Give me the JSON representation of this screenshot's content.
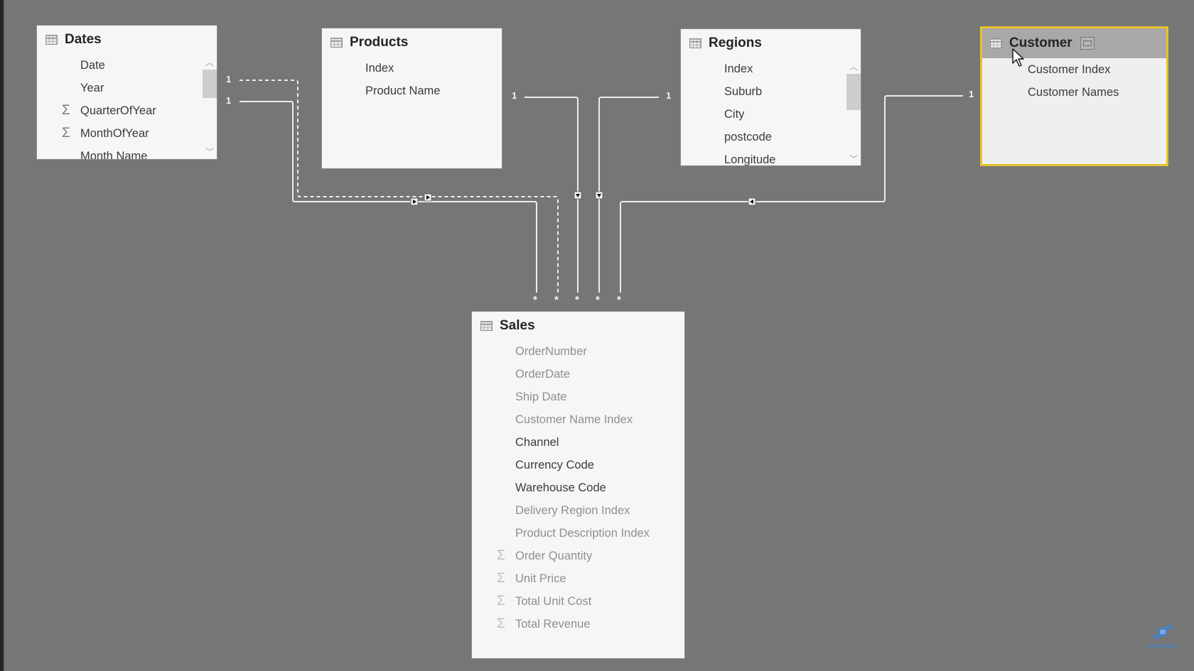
{
  "canvas": {
    "background": "#767676",
    "view": "Model relationships"
  },
  "tables": {
    "dates": {
      "title": "Dates",
      "fields": [
        {
          "name": "Date",
          "sigma": false
        },
        {
          "name": "Year",
          "sigma": false
        },
        {
          "name": "QuarterOfYear",
          "sigma": true
        },
        {
          "name": "MonthOfYear",
          "sigma": true
        },
        {
          "name": "Month Name",
          "sigma": false
        }
      ],
      "scrollable": true
    },
    "products": {
      "title": "Products",
      "fields": [
        {
          "name": "Index",
          "sigma": false
        },
        {
          "name": "Product Name",
          "sigma": false
        }
      ]
    },
    "regions": {
      "title": "Regions",
      "fields": [
        {
          "name": "Index",
          "sigma": false
        },
        {
          "name": "Suburb",
          "sigma": false
        },
        {
          "name": "City",
          "sigma": false
        },
        {
          "name": "postcode",
          "sigma": false
        },
        {
          "name": "Longitude",
          "sigma": false
        }
      ],
      "scrollable": true
    },
    "customer": {
      "title": "Customer",
      "selected": true,
      "highlight_color": "#e6c229",
      "fields": [
        {
          "name": "Customer Index",
          "sigma": false
        },
        {
          "name": "Customer Names",
          "sigma": false
        }
      ]
    },
    "sales": {
      "title": "Sales",
      "fields": [
        {
          "name": "OrderNumber",
          "sigma": false,
          "hidden": true
        },
        {
          "name": "OrderDate",
          "sigma": false,
          "hidden": true
        },
        {
          "name": "Ship Date",
          "sigma": false,
          "hidden": true
        },
        {
          "name": "Customer Name Index",
          "sigma": false,
          "hidden": true
        },
        {
          "name": "Channel",
          "sigma": false,
          "hidden": false
        },
        {
          "name": "Currency Code",
          "sigma": false,
          "hidden": false
        },
        {
          "name": "Warehouse Code",
          "sigma": false,
          "hidden": false
        },
        {
          "name": "Delivery Region Index",
          "sigma": false,
          "hidden": true
        },
        {
          "name": "Product Description Index",
          "sigma": false,
          "hidden": true
        },
        {
          "name": "Order Quantity",
          "sigma": true,
          "hidden": true
        },
        {
          "name": "Unit Price",
          "sigma": true,
          "hidden": true
        },
        {
          "name": "Total Unit Cost",
          "sigma": true,
          "hidden": true
        },
        {
          "name": "Total Revenue",
          "sigma": true,
          "hidden": true
        }
      ]
    }
  },
  "relationships": [
    {
      "from": "Dates",
      "to": "Sales",
      "one_label": "1",
      "many_label": "*",
      "active": false
    },
    {
      "from": "Dates",
      "to": "Sales",
      "one_label": "1",
      "many_label": "*",
      "active": true
    },
    {
      "from": "Products",
      "to": "Sales",
      "one_label": "1",
      "many_label": "*",
      "active": true
    },
    {
      "from": "Regions",
      "to": "Sales",
      "one_label": "1",
      "many_label": "*",
      "active": true
    },
    {
      "from": "Customer",
      "to": "Sales",
      "one_label": "1",
      "many_label": "*",
      "active": true
    }
  ],
  "labels": {
    "one": "1",
    "many": "*"
  },
  "watermark": {
    "text": "SUBSCRIBE",
    "icon": "dna-icon",
    "color": "#3f86d6"
  }
}
